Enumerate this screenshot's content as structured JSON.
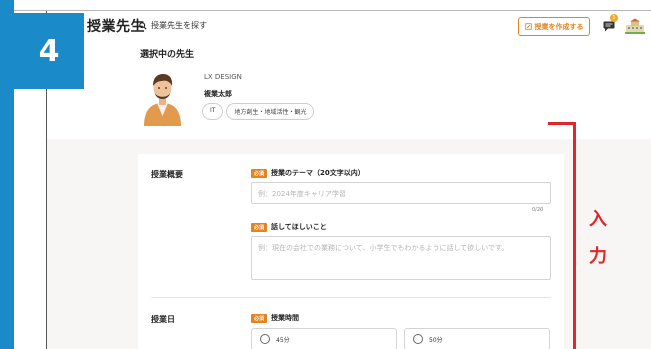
{
  "step": {
    "number": "4"
  },
  "header": {
    "logo": "授業先生",
    "search_label": "授業先生を探す",
    "create_button": "授業を作成する",
    "notification_count": "1"
  },
  "teacher": {
    "section_title": "選択中の先生",
    "company": "LX DESIGN",
    "name": "複業太郎",
    "tags": [
      "IT",
      "地方創生・地域活性・観光"
    ]
  },
  "form": {
    "overview_label": "授業概要",
    "required_badge": "必須",
    "theme_label": "授業のテーマ（20文字以内）",
    "theme_placeholder": "例：2024年度キャリア学習",
    "theme_counter": "0/20",
    "content_label": "話してほしいこと",
    "content_placeholder": "例：現在の会社での業務について、小学生でもわかるように話して欲しいです。",
    "date_label": "授業日",
    "time_label": "授業時間",
    "time_options": [
      "45分",
      "50分"
    ]
  },
  "annotation": {
    "char1": "入",
    "char2": "力"
  },
  "colors": {
    "accent": "#e8821e",
    "frame_blue": "#1a8ac8",
    "annotation_red": "#e0262b"
  }
}
